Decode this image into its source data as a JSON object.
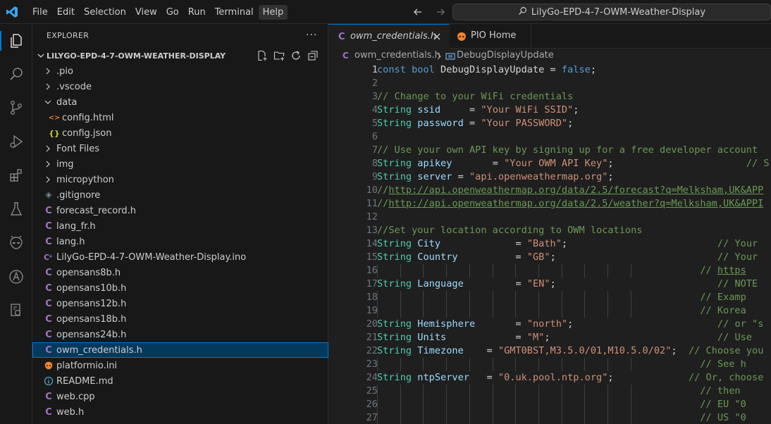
{
  "menu": [
    "File",
    "Edit",
    "Selection",
    "View",
    "Go",
    "Run",
    "Terminal",
    "Help"
  ],
  "search": {
    "text": "LilyGo-EPD-4-7-OWM-Weather-Display"
  },
  "sidebar": {
    "header": "EXPLORER",
    "more": "···",
    "root": "LILYGO-EPD-4-7-OWM-WEATHER-DISPLAY",
    "items": [
      {
        "label": ".pio",
        "kind": "folder",
        "depth": 0,
        "open": false
      },
      {
        "label": ".vscode",
        "kind": "folder",
        "depth": 0,
        "open": false
      },
      {
        "label": "data",
        "kind": "folder",
        "depth": 0,
        "open": true
      },
      {
        "label": "config.html",
        "kind": "html",
        "depth": 1
      },
      {
        "label": "config.json",
        "kind": "json",
        "depth": 1
      },
      {
        "label": "Font Files",
        "kind": "folder",
        "depth": 0,
        "open": false
      },
      {
        "label": "img",
        "kind": "folder",
        "depth": 0,
        "open": false
      },
      {
        "label": "micropython",
        "kind": "folder",
        "depth": 0,
        "open": false
      },
      {
        "label": ".gitignore",
        "kind": "git",
        "depth": 0
      },
      {
        "label": "forecast_record.h",
        "kind": "c",
        "depth": 0
      },
      {
        "label": "lang_fr.h",
        "kind": "c",
        "depth": 0
      },
      {
        "label": "lang.h",
        "kind": "c",
        "depth": 0
      },
      {
        "label": "LilyGo-EPD-4-7-OWM-Weather-Display.ino",
        "kind": "ino",
        "depth": 0
      },
      {
        "label": "opensans8b.h",
        "kind": "c",
        "depth": 0
      },
      {
        "label": "opensans10b.h",
        "kind": "c",
        "depth": 0
      },
      {
        "label": "opensans12b.h",
        "kind": "c",
        "depth": 0
      },
      {
        "label": "opensans18b.h",
        "kind": "c",
        "depth": 0
      },
      {
        "label": "opensans24b.h",
        "kind": "c",
        "depth": 0
      },
      {
        "label": "owm_credentials.h",
        "kind": "c",
        "depth": 0,
        "selected": true
      },
      {
        "label": "platformio.ini",
        "kind": "pio",
        "depth": 0
      },
      {
        "label": "README.md",
        "kind": "info",
        "depth": 0
      },
      {
        "label": "web.cpp",
        "kind": "c",
        "depth": 0
      },
      {
        "label": "web.h",
        "kind": "c",
        "depth": 0
      }
    ]
  },
  "tabs": [
    {
      "label": "owm_credentials.h",
      "active": true
    },
    {
      "label": "PIO Home",
      "active": false
    }
  ],
  "breadcrumb": {
    "file": "owm_credentials.h",
    "symbol": "DebugDisplayUpdate"
  },
  "colors": {
    "accent": "#0078d4",
    "c_icon": "#a074c4",
    "json_icon": "#cbcb41",
    "html_icon": "#e37933",
    "pio_icon": "#f5822a"
  },
  "code": {
    "current_line": 1,
    "lines": [
      {
        "n": "1",
        "guides": 0,
        "seg": [
          [
            "kw",
            "const "
          ],
          [
            "kw",
            "bool "
          ],
          [
            "pl",
            "DebugDisplayUpdate = "
          ],
          [
            "kw",
            "false"
          ],
          [
            "pl",
            ";"
          ]
        ]
      },
      {
        "n": "2",
        "guides": 0,
        "seg": []
      },
      {
        "n": "3",
        "guides": 0,
        "seg": [
          [
            "cm",
            "// Change to your WiFi credentials"
          ]
        ]
      },
      {
        "n": "4",
        "guides": 0,
        "seg": [
          [
            "ty",
            "String "
          ],
          [
            "vr",
            "ssid"
          ],
          [
            "pl",
            "     = "
          ],
          [
            "st",
            "\"Your WiFi SSID\""
          ],
          [
            "pl",
            ";"
          ]
        ]
      },
      {
        "n": "5",
        "guides": 0,
        "seg": [
          [
            "ty",
            "String "
          ],
          [
            "vr",
            "password"
          ],
          [
            "pl",
            " = "
          ],
          [
            "st",
            "\"Your PASSWORD\""
          ],
          [
            "pl",
            ";"
          ]
        ]
      },
      {
        "n": "6",
        "guides": 0,
        "seg": []
      },
      {
        "n": "7",
        "guides": 0,
        "seg": [
          [
            "cm",
            "// Use your own API key by signing up for a free developer account"
          ]
        ]
      },
      {
        "n": "8",
        "guides": 0,
        "seg": [
          [
            "ty",
            "String "
          ],
          [
            "vr",
            "apikey"
          ],
          [
            "pl",
            "       = "
          ],
          [
            "st",
            "\"Your OWM API Key\""
          ],
          [
            "pl",
            ";"
          ],
          [
            "pl",
            "                       "
          ],
          [
            "cm",
            "// S"
          ]
        ]
      },
      {
        "n": "9",
        "guides": 0,
        "seg": [
          [
            "ty",
            "String "
          ],
          [
            "vr",
            "server"
          ],
          [
            "pl",
            " = "
          ],
          [
            "st",
            "\"api.openweathermap.org\""
          ],
          [
            "pl",
            ";"
          ]
        ]
      },
      {
        "n": "10",
        "guides": 0,
        "seg": [
          [
            "cm",
            "//"
          ],
          [
            "lnk",
            "http://api.openweathermap.org/data/2.5/forecast?q=Melksham,UK&APP"
          ]
        ]
      },
      {
        "n": "11",
        "guides": 0,
        "seg": [
          [
            "cm",
            "//"
          ],
          [
            "lnk",
            "http://api.openweathermap.org/data/2.5/weather?q=Melksham,UK&APPI"
          ]
        ]
      },
      {
        "n": "12",
        "guides": 0,
        "seg": []
      },
      {
        "n": "13",
        "guides": 0,
        "seg": [
          [
            "cm",
            "//Set your location according to OWM locations"
          ]
        ]
      },
      {
        "n": "14",
        "guides": 0,
        "seg": [
          [
            "ty",
            "String "
          ],
          [
            "vr",
            "City"
          ],
          [
            "pl",
            "             = "
          ],
          [
            "st",
            "\"Bath\""
          ],
          [
            "pl",
            ";"
          ],
          [
            "pl",
            "                          "
          ],
          [
            "cm",
            "// Your"
          ]
        ]
      },
      {
        "n": "15",
        "guides": 0,
        "seg": [
          [
            "ty",
            "String "
          ],
          [
            "vr",
            "Country"
          ],
          [
            "pl",
            "          = "
          ],
          [
            "st",
            "\"GB\""
          ],
          [
            "pl",
            ";"
          ],
          [
            "pl",
            "                            "
          ],
          [
            "cm",
            "// Your"
          ]
        ]
      },
      {
        "n": "16",
        "guides": 12,
        "seg": [
          [
            "pl",
            "                                                        "
          ],
          [
            "cm",
            "// "
          ],
          [
            "lnk",
            "https"
          ]
        ]
      },
      {
        "n": "17",
        "guides": 0,
        "seg": [
          [
            "ty",
            "String "
          ],
          [
            "vr",
            "Language"
          ],
          [
            "pl",
            "         = "
          ],
          [
            "st",
            "\"EN\""
          ],
          [
            "pl",
            ";"
          ],
          [
            "pl",
            "                            "
          ],
          [
            "cm",
            "// NOTE"
          ]
        ]
      },
      {
        "n": "18",
        "guides": 12,
        "seg": [
          [
            "pl",
            "                                                        "
          ],
          [
            "cm",
            "// Examp"
          ]
        ]
      },
      {
        "n": "19",
        "guides": 12,
        "seg": [
          [
            "pl",
            "                                                        "
          ],
          [
            "cm",
            "// Korea"
          ]
        ]
      },
      {
        "n": "20",
        "guides": 0,
        "seg": [
          [
            "ty",
            "String "
          ],
          [
            "vr",
            "Hemisphere"
          ],
          [
            "pl",
            "       = "
          ],
          [
            "st",
            "\"north\""
          ],
          [
            "pl",
            ";"
          ],
          [
            "pl",
            "                         "
          ],
          [
            "cm",
            "// or \"s"
          ]
        ]
      },
      {
        "n": "21",
        "guides": 0,
        "seg": [
          [
            "ty",
            "String "
          ],
          [
            "vr",
            "Units"
          ],
          [
            "pl",
            "            = "
          ],
          [
            "st",
            "\"M\""
          ],
          [
            "pl",
            ";"
          ],
          [
            "pl",
            "                             "
          ],
          [
            "cm",
            "// Use "
          ]
        ]
      },
      {
        "n": "22",
        "guides": 0,
        "seg": [
          [
            "ty",
            "String "
          ],
          [
            "vr",
            "Timezone"
          ],
          [
            "pl",
            "    = "
          ],
          [
            "st",
            "\"GMT0BST,M3.5.0/01,M10.5.0/02\""
          ],
          [
            "pl",
            ";"
          ],
          [
            "pl",
            "  "
          ],
          [
            "cm",
            "// Choose you"
          ]
        ]
      },
      {
        "n": "23",
        "guides": 12,
        "seg": [
          [
            "pl",
            "                                                        "
          ],
          [
            "cm",
            "// See h"
          ]
        ]
      },
      {
        "n": "24",
        "guides": 0,
        "seg": [
          [
            "ty",
            "String "
          ],
          [
            "vr",
            "ntpServer"
          ],
          [
            "pl",
            "   = "
          ],
          [
            "st",
            "\"0.uk.pool.ntp.org\""
          ],
          [
            "pl",
            ";"
          ],
          [
            "pl",
            "             "
          ],
          [
            "cm",
            "// Or, choose"
          ]
        ]
      },
      {
        "n": "25",
        "guides": 12,
        "seg": [
          [
            "pl",
            "                                                        "
          ],
          [
            "cm",
            "// then "
          ]
        ]
      },
      {
        "n": "26",
        "guides": 12,
        "seg": [
          [
            "pl",
            "                                                        "
          ],
          [
            "cm",
            "// EU \"0"
          ]
        ]
      },
      {
        "n": "27",
        "guides": 12,
        "seg": [
          [
            "pl",
            "                                                        "
          ],
          [
            "cm",
            "// US \"0"
          ]
        ]
      }
    ]
  }
}
